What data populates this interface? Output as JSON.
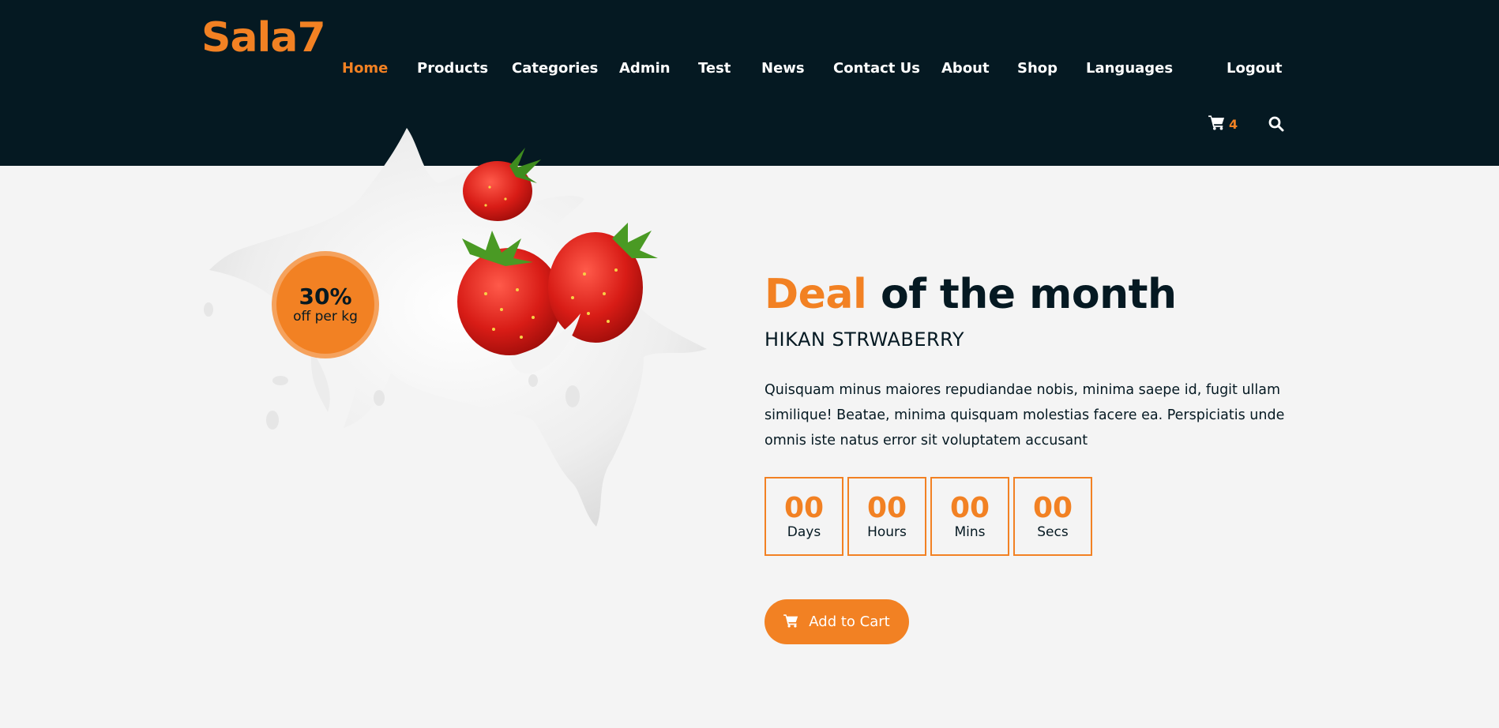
{
  "header": {
    "logo": "Sala7",
    "nav": [
      {
        "label": "Home",
        "active": true
      },
      {
        "label": "Products"
      },
      {
        "label": "Categories"
      },
      {
        "label": "Admin"
      },
      {
        "label": "Test"
      },
      {
        "label": "News"
      },
      {
        "label": "Contact Us"
      },
      {
        "label": "About"
      },
      {
        "label": "Shop"
      },
      {
        "label": "Languages"
      },
      {
        "label": "Logout"
      }
    ],
    "cart": {
      "icon": "shopping-cart-icon",
      "count": "4"
    },
    "search": {
      "icon": "search-icon"
    }
  },
  "deal": {
    "badge": {
      "percent": "30%",
      "subtitle": "off per kg"
    },
    "title_accent": "Deal",
    "title_rest": "of the month",
    "product_name": "HIKAN STRWABERRY",
    "description": "Quisquam minus maiores repudiandae nobis, minima saepe id, fugit ullam similique! Beatae, minima quisquam molestias facere ea. Perspiciatis unde omnis iste natus error sit voluptatem accusant",
    "countdown": [
      {
        "value": "00",
        "label": "Days"
      },
      {
        "value": "00",
        "label": "Hours"
      },
      {
        "value": "00",
        "label": "Mins"
      },
      {
        "value": "00",
        "label": "Secs"
      }
    ],
    "add_to_cart": "Add to Cart"
  },
  "colors": {
    "accent": "#F28123",
    "dark": "#051922",
    "background": "#f4f4f4"
  }
}
